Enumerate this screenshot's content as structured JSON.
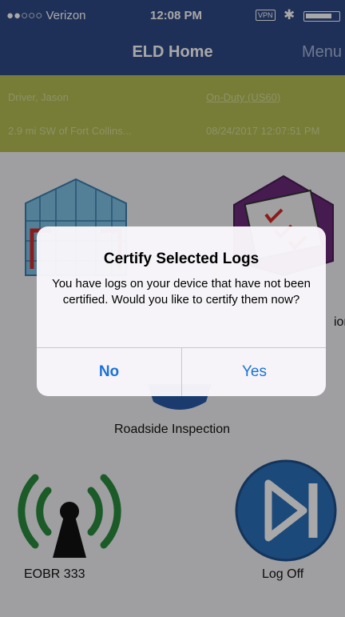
{
  "status_bar": {
    "carrier": "●●○○○ Verizon",
    "time": "12:08 PM",
    "vpn": "VPN"
  },
  "nav": {
    "title": "ELD Home",
    "menu": "Menu"
  },
  "driver_info": {
    "driver": "Driver, Jason",
    "duty_status": "On-Duty (US60)",
    "location": "2.9 mi SW of Fort Collins...",
    "datetime": "08/24/2017 12:07:51 PM"
  },
  "tiles": {
    "truck_label": "",
    "logs_label": "ion",
    "roadside_label": "Roadside Inspection",
    "eobr_label": "EOBR 333",
    "logoff_label": "Log Off"
  },
  "alert": {
    "title": "Certify Selected Logs",
    "message": "You have logs on your device that have not been certified. Would you like to certify them now?",
    "no_label": "No",
    "yes_label": "Yes"
  },
  "colors": {
    "nav_blue": "#2f4a86",
    "info_olive": "#b5bd52",
    "alert_button_blue": "#1a72d9",
    "eobr_green": "#2a8a3e",
    "logoff_blue": "#2a6fb8"
  }
}
